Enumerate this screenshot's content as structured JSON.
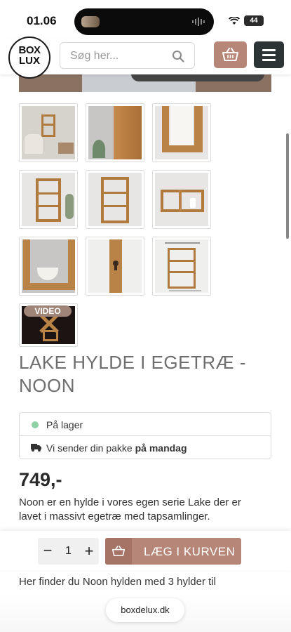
{
  "status_bar": {
    "time": "01.06",
    "battery": "44"
  },
  "header": {
    "logo_line1": "BOX",
    "logo_line2": "LUX",
    "search_placeholder": "Søg her..."
  },
  "thumbnails": [
    {
      "kind": "room-shelf"
    },
    {
      "kind": "shelf-corner"
    },
    {
      "kind": "shelf-edge"
    },
    {
      "kind": "shelf-tall"
    },
    {
      "kind": "shelf-tall-2"
    },
    {
      "kind": "shelf-wide"
    },
    {
      "kind": "shelf-bowl"
    },
    {
      "kind": "keyhole"
    },
    {
      "kind": "dimensions"
    },
    {
      "kind": "video",
      "badge": "VIDEO"
    }
  ],
  "product": {
    "title": "LAKE HYLDE I EGETRÆ - NOON",
    "stock_status": "På lager",
    "shipping_prefix": "Vi sender din pakke",
    "shipping_day": "på mandag",
    "price": "749,-",
    "description": "Noon er en hylde i vores egen serie Lake der er lavet i massivt egetræ med tapsamlinger.",
    "description_cont": "Her finder du Noon hylden med 3 hylder til"
  },
  "cart_bar": {
    "quantity": "1",
    "minus_label": "−",
    "plus_label": "+",
    "add_label": "LÆG I KURVEN"
  },
  "browser": {
    "url": "boxdelux.dk"
  },
  "colors": {
    "accent": "#b68678",
    "dark_button": "#2d3435",
    "stock_dot": "#8fd1a6",
    "wood": "#b07a3d"
  }
}
